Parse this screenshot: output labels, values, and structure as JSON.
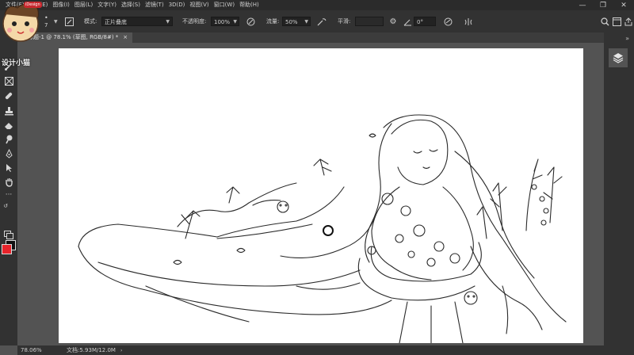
{
  "menu": [
    "文件(F)",
    "编辑(E)",
    "图像(I)",
    "图层(L)",
    "文字(Y)",
    "选择(S)",
    "滤镜(T)",
    "3D(D)",
    "视图(V)",
    "窗口(W)",
    "帮助(H)"
  ],
  "options": {
    "brush_size": "7",
    "mode_label": "模式:",
    "mode_value": "正片叠底",
    "opacity_label": "不透明度:",
    "opacity_value": "100%",
    "flow_label": "流量:",
    "flow_value": "50%",
    "smoothing_label": "平滑:",
    "smoothing_value": "",
    "angle_value": "0°"
  },
  "tab": {
    "title": "未标题-1 @ 78.1% (草图, RGB/8#) *",
    "close": "×"
  },
  "status": {
    "zoom": "78.06%",
    "doc": "文档:5.93M/12.0M"
  },
  "watermark": "设计小猫",
  "avatar_badge": "iDesign",
  "colors": {
    "foreground": "#e8242b",
    "background": "#111111"
  },
  "icons": [
    "brush-icon",
    "airbrush-icon",
    "pressure-icon",
    "gear-icon",
    "angle-icon",
    "symmetry-icon",
    "search-icon",
    "workspace-icon",
    "share-icon",
    "layers-icon"
  ]
}
